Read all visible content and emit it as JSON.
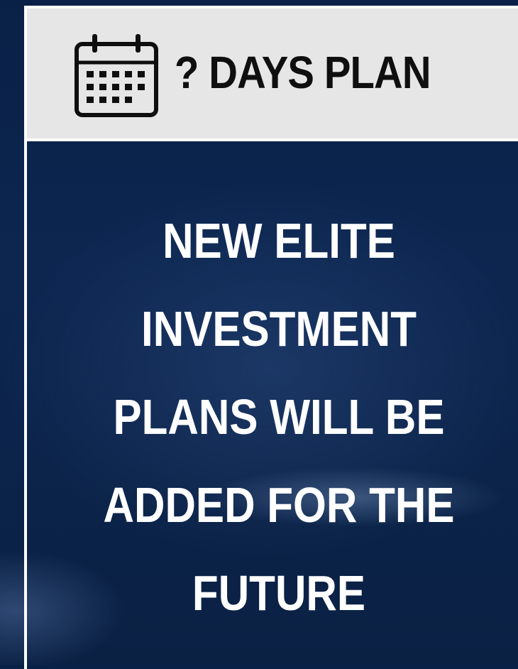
{
  "header": {
    "icon": "calendar-icon",
    "title": "? DAYS PLAN"
  },
  "body": {
    "message_lines": [
      "NEW ELITE",
      "INVESTMENT",
      "PLANS WILL BE",
      "ADDED FOR THE",
      "FUTURE"
    ]
  },
  "colors": {
    "header_background": "#e6e6e6",
    "header_text": "#0f0f0f",
    "body_background": "#0c2650",
    "body_text": "#ffffff",
    "border": "#ffffff"
  }
}
